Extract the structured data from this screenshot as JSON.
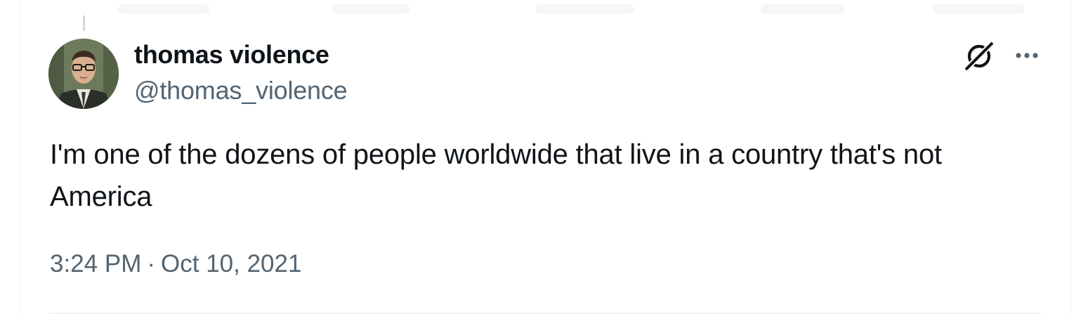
{
  "tweet": {
    "author": {
      "display_name": "thomas violence",
      "handle": "@thomas_violence",
      "avatar_icon": "avatar-photo"
    },
    "text": "I'm one of the dozens of people worldwide that live in a country that's not America",
    "time": "3:24 PM",
    "separator": "·",
    "date": "Oct 10, 2021"
  },
  "actions": {
    "grok_icon": "grok-slash-icon",
    "more_icon": "more-horizontal-icon"
  },
  "colors": {
    "text_primary": "#0f1419",
    "text_secondary": "#536471",
    "border": "#eff3f4",
    "thread_line": "#cfd9de"
  }
}
